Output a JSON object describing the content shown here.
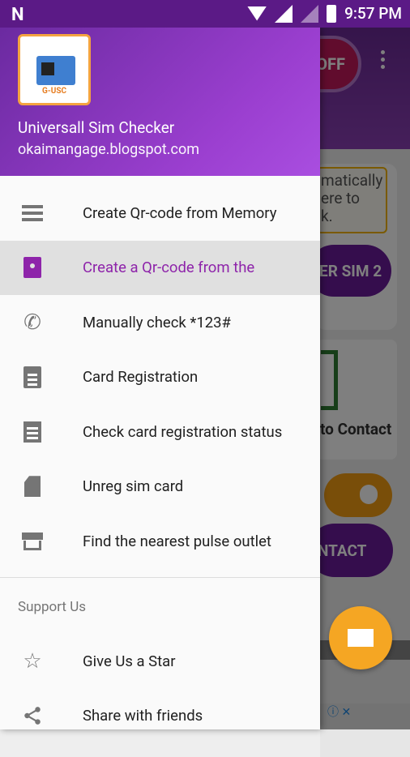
{
  "status_bar": {
    "time": "9:57 PM",
    "notification_icon": "N"
  },
  "background": {
    "off_label": "OFF",
    "notice_text": "matically\nere to\nk.",
    "sim2_label": "ER SIM 2",
    "to_contact": "to Contact",
    "contact_label": "NTACT"
  },
  "drawer": {
    "app_name": "Universall Sim Checker",
    "app_url": "okaimangage.blogspot.com",
    "logo_label": "G-USC",
    "items": [
      {
        "label": "Create Qr-code from Memory",
        "icon": "list-icon",
        "active": false
      },
      {
        "label": "Create a Qr-code from the",
        "icon": "contact-card-icon",
        "active": true
      },
      {
        "label": "Manually check *123#",
        "icon": "sip-phone-icon",
        "active": false
      },
      {
        "label": "Card Registration",
        "icon": "clipboard-icon",
        "active": false
      },
      {
        "label": "Check card registration status",
        "icon": "receipt-icon",
        "active": false
      },
      {
        "label": "Unreg sim card",
        "icon": "no-sim-icon",
        "active": false
      },
      {
        "label": "Find the nearest pulse outlet",
        "icon": "store-icon",
        "active": false
      }
    ],
    "section_title": "Support Us",
    "support_items": [
      {
        "label": "Give Us a Star",
        "icon": "star-icon"
      },
      {
        "label": "Share with friends",
        "icon": "share-icon"
      }
    ]
  },
  "colors": {
    "primary": "#6a1b9a",
    "accent": "#8e24aa",
    "fab": "#f5a623"
  }
}
